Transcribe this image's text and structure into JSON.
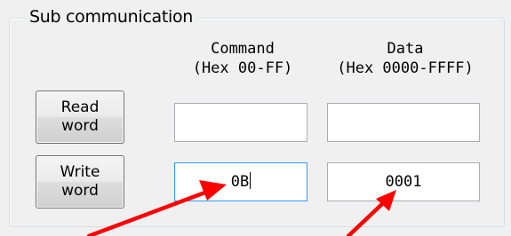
{
  "group": {
    "title": "Sub communication"
  },
  "columns": {
    "command": {
      "label": "Command",
      "range": "(Hex 00-FF)"
    },
    "data": {
      "label": "Data",
      "range": "(Hex 0000-FFFF)"
    }
  },
  "rows": [
    {
      "button": "Read\nword",
      "command_value": "",
      "data_value": ""
    },
    {
      "button": "Write\nword",
      "command_value": "0B",
      "data_value": "0001"
    }
  ],
  "colors": {
    "arrow": "#ff0000",
    "focus_border": "#3399ff"
  },
  "icons": [
    "arrow-annotation-icon"
  ]
}
